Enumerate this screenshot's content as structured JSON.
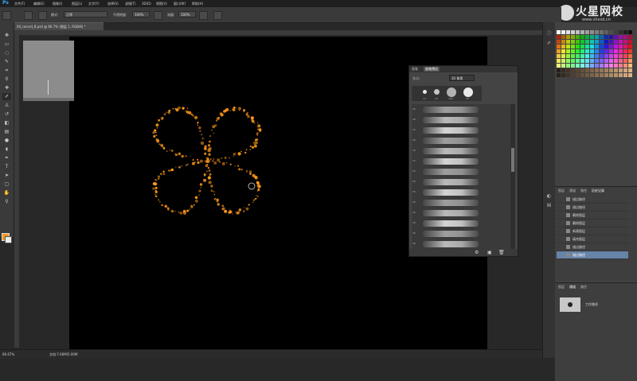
{
  "app": {
    "logo": "Ps"
  },
  "menu": [
    "文件(F)",
    "编辑(E)",
    "图像(I)",
    "图层(L)",
    "文字(Y)",
    "选择(S)",
    "滤镜(T)",
    "3D(D)",
    "视图(V)",
    "窗口(W)",
    "帮助(H)"
  ],
  "site_logo": {
    "title": "火星网校",
    "url": "www.vhxsd.cn"
  },
  "options": {
    "mode_label": "模式:",
    "mode_value": "正常",
    "opacity_label": "不透明度:",
    "opacity_value": "100%",
    "flow_label": "流量:",
    "flow_value": "100%"
  },
  "document": {
    "tab_title": "04_record_8.psd @ 66.7% (图层 1, RGB/8) *"
  },
  "status": {
    "zoom": "66.67%",
    "doc_size": "文档:7.66M/5.00M"
  },
  "brush_panel": {
    "tabs": [
      "画笔",
      "画笔预设"
    ],
    "size_label": "大小:",
    "size_value": "30 像素",
    "preset_sizes": [
      "13",
      "19",
      "100",
      "25"
    ],
    "list_sizes": [
      "25",
      "36",
      "25",
      "36",
      "36",
      "32",
      "25",
      "50",
      "25",
      "36",
      "32",
      "39",
      "36",
      "36"
    ]
  },
  "history_panel": {
    "tabs": [
      "图层",
      "通道",
      "路径",
      "历史记录"
    ],
    "items": [
      "描边路径",
      "描边路径",
      "删除图层",
      "删除图层",
      "新建图层",
      "填充图层",
      "描边路径",
      "描边路径"
    ],
    "selected_index": 7
  },
  "layers_panel": {
    "tabs": [
      "图层",
      "通道",
      "路径"
    ],
    "layer_name": "工作路径"
  },
  "colors": {
    "foreground": "#f39a1c",
    "background": "#eeeeee",
    "sparkle": "#ff9a1a",
    "selection": "#6783a8"
  }
}
